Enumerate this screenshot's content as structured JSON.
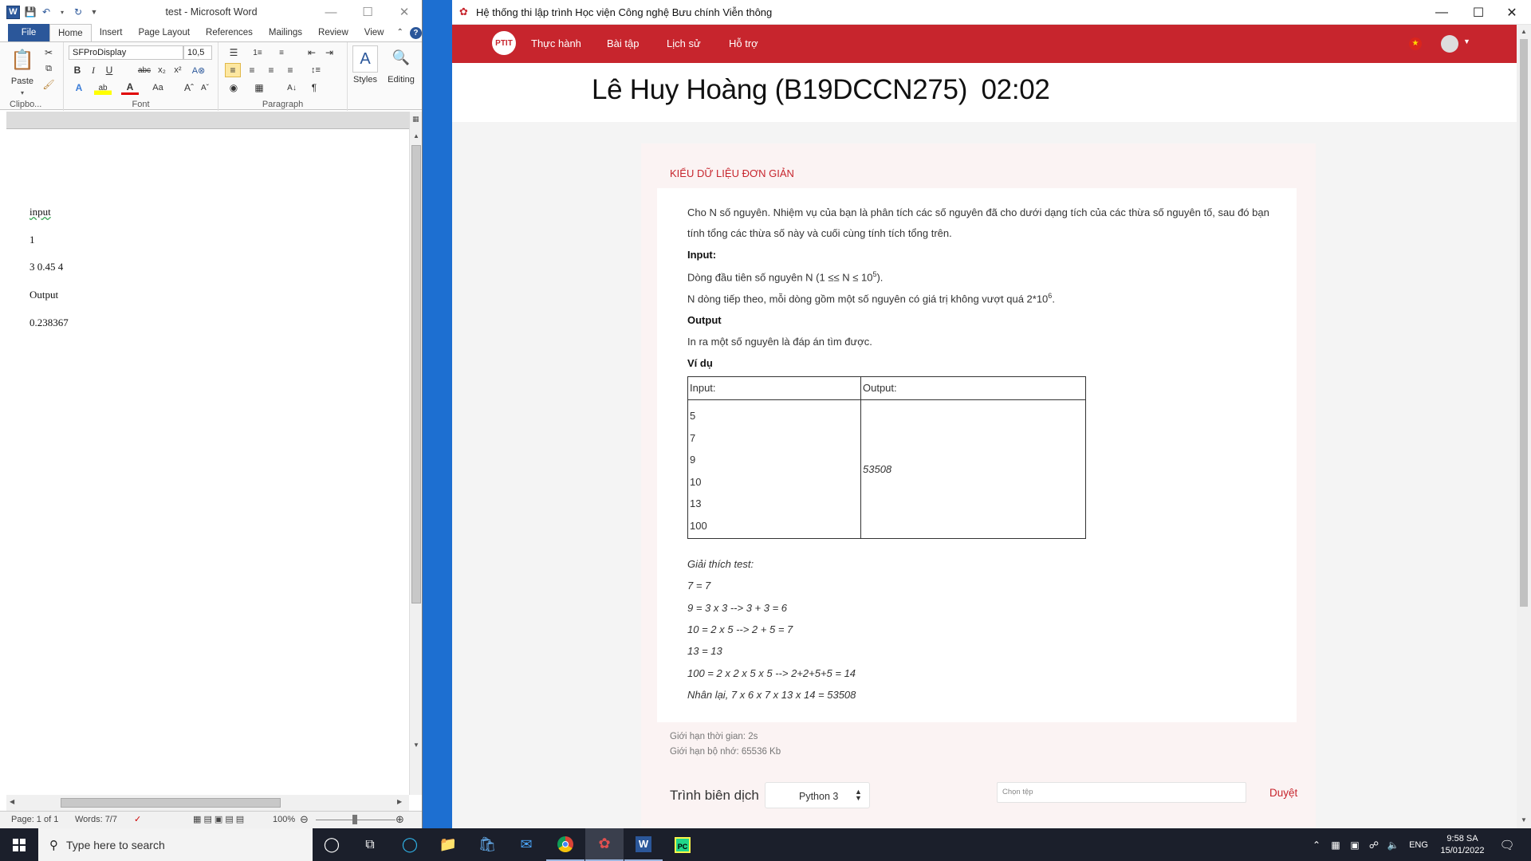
{
  "word": {
    "title": "test  -  Microsoft Word",
    "tabs": [
      "File",
      "Home",
      "Insert",
      "Page Layout",
      "References",
      "Mailings",
      "Review",
      "View"
    ],
    "font_name": "SFProDisplay",
    "font_size": "10,5",
    "paste_label": "Paste",
    "styles_label": "Styles",
    "editing_label": "Editing",
    "groups": {
      "clipboard": "Clipbo...",
      "font": "Font",
      "paragraph": "Paragraph"
    },
    "doc_lines": [
      "input",
      "1",
      "3 0.45 4",
      "Output",
      "0.238367"
    ],
    "status": {
      "page": "Page: 1 of 1",
      "words": "Words: 7/7",
      "zoom": "100%"
    }
  },
  "browser": {
    "title": "Hệ thống thi lập trình Học viện Công nghệ Bưu chính Viễn thông",
    "nav": [
      "Thực hành",
      "Bài tập",
      "Lịch sử",
      "Hỗ trợ"
    ],
    "header": {
      "student": "Lê Huy Hoàng (B19DCCN275)",
      "timer": "02:02"
    },
    "problem": {
      "category": "KIỂU DỮ LIỆU ĐƠN GIẢN",
      "desc1": "Cho N số nguyên. Nhiệm vụ của bạn là phân tích các số nguyên đã cho dưới dạng tích của các thừa số nguyên tố, sau đó bạn",
      "desc2": "tính tổng các thừa số này và cuối cùng tính tích tổng trên.",
      "input_h": "Input:",
      "input1_pre": "Dòng đầu tiên số nguyên N (1 ≤≤ N ≤ 10",
      "input1_sup": "5",
      "input1_post": ").",
      "input2_pre": "N dòng tiếp theo, mỗi dòng gồm một số nguyên có giá trị không vượt quá 2*10",
      "input2_sup": "6",
      "input2_post": ".",
      "output_h": "Output",
      "output1": "In ra một số nguyên là đáp án tìm được.",
      "example_h": "Ví dụ",
      "table": {
        "col_input": "Input:",
        "col_output": "Output:",
        "inputs": [
          "5",
          "7",
          "9",
          "10",
          "13",
          "100"
        ],
        "output": "53508"
      },
      "explain": [
        "Giải thích test:",
        "7 = 7",
        "9 = 3 x 3 --> 3 + 3 = 6",
        "10 = 2 x 5 --> 2 + 5 = 7",
        "13 = 13",
        "100 = 2 x 2 x 5 x 5 --> 2+2+5+5 = 14",
        "Nhân lại, 7 x 6 x 7 x 13 x 14 = 53508"
      ],
      "time_limit": "Giới hạn thời gian: 2s",
      "memory_limit": "Giới hạn bộ nhớ: 65536 Kb"
    },
    "submit": {
      "compiler_label": "Trình biên dịch",
      "compiler_value": "Python 3",
      "file_placeholder": "Chọn tệp",
      "browse": "Duyệt"
    }
  },
  "taskbar": {
    "search_placeholder": "Type here to search",
    "lang": "ENG",
    "time": "9:58 SA",
    "date": "15/01/2022"
  },
  "colors": {
    "accent_red": "#c7252d",
    "word_blue": "#2b579a"
  }
}
